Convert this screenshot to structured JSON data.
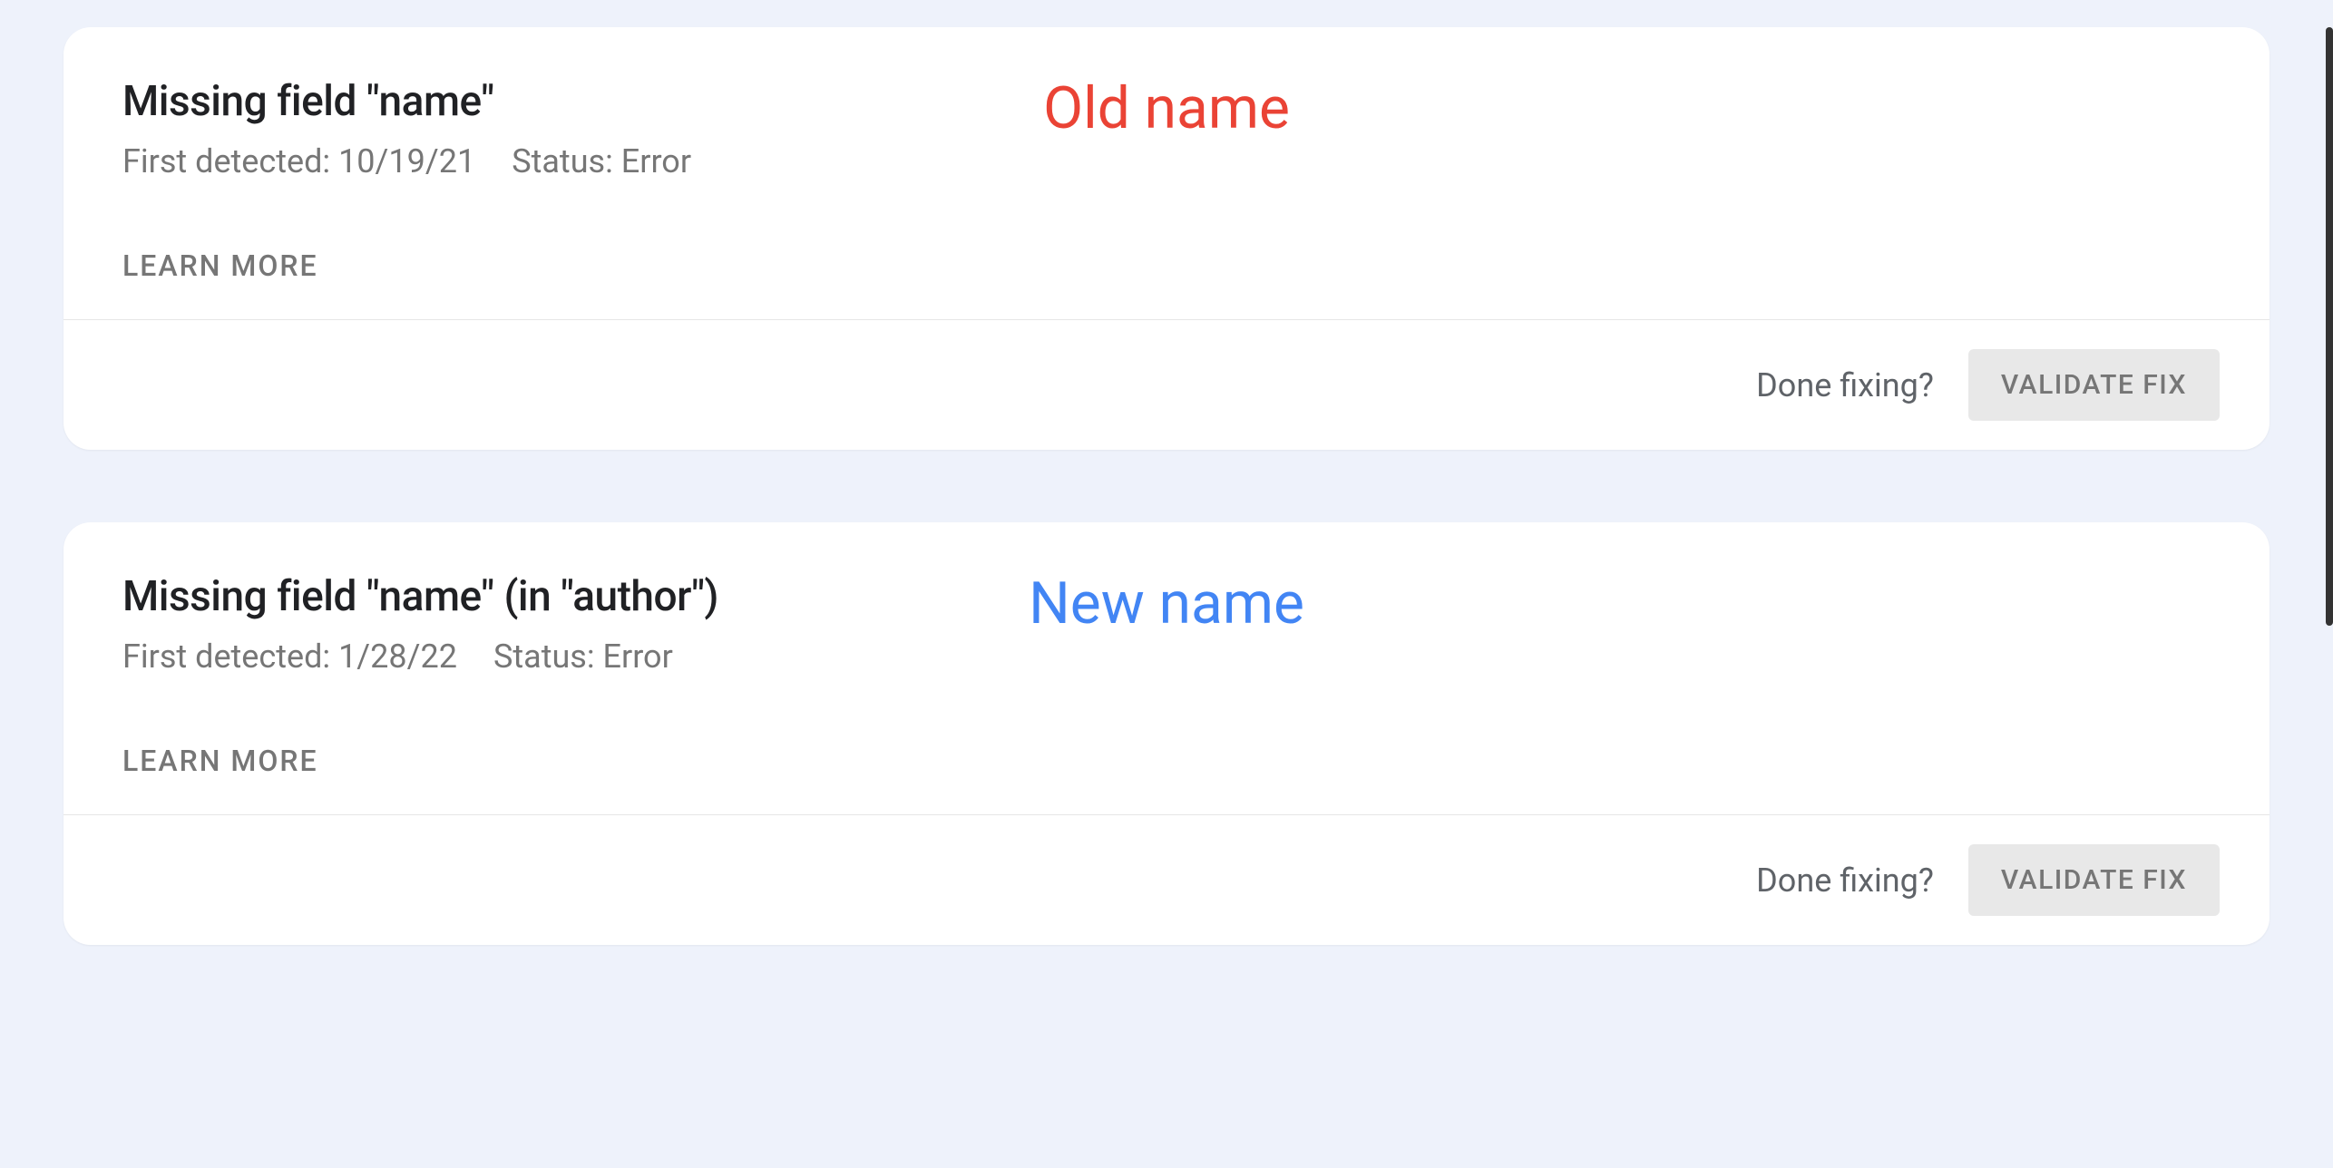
{
  "cards": [
    {
      "title": "Missing field \"name\"",
      "first_detected_label": "First detected:",
      "first_detected_value": "10/19/21",
      "status_label": "Status:",
      "status_value": "Error",
      "learn_more": "LEARN MORE",
      "done_fixing": "Done fixing?",
      "validate_fix": "VALIDATE FIX",
      "annotation": "Old name",
      "annotation_style": "old"
    },
    {
      "title": "Missing field \"name\" (in \"author\")",
      "first_detected_label": "First detected:",
      "first_detected_value": "1/28/22",
      "status_label": "Status:",
      "status_value": "Error",
      "learn_more": "LEARN MORE",
      "done_fixing": "Done fixing?",
      "validate_fix": "VALIDATE FIX",
      "annotation": "New name",
      "annotation_style": "new"
    }
  ]
}
